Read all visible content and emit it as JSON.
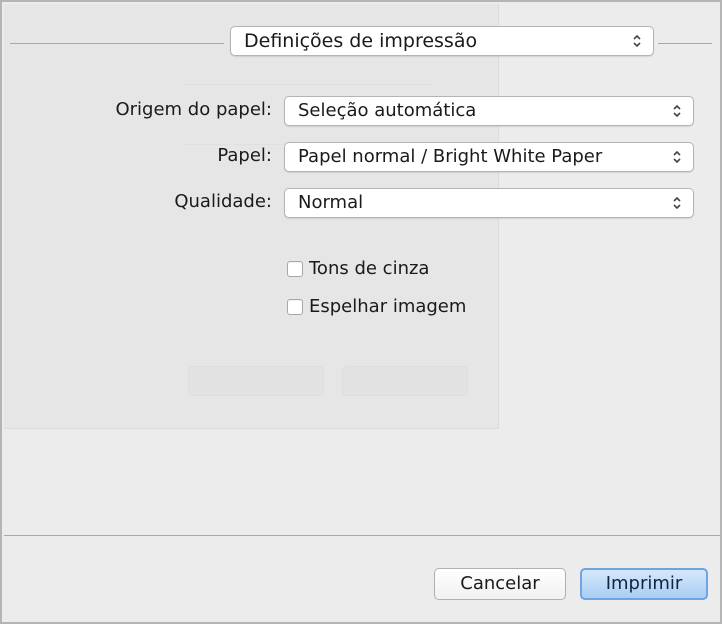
{
  "settings_menu": {
    "label": "Definições de impressão"
  },
  "fields": {
    "paper_source": {
      "label": "Origem do papel:",
      "value": "Seleção automática"
    },
    "paper": {
      "label": "Papel:",
      "value": "Papel normal / Bright White Paper"
    },
    "quality": {
      "label": "Qualidade:",
      "value": "Normal"
    }
  },
  "options": {
    "grayscale": {
      "label": "Tons de cinza",
      "checked": false
    },
    "mirror": {
      "label": "Espelhar imagem",
      "checked": false
    }
  },
  "buttons": {
    "cancel": "Cancelar",
    "print": "Imprimir"
  },
  "colors": {
    "accent": "#6ea4e2",
    "dialog_bg": "#ececec"
  }
}
